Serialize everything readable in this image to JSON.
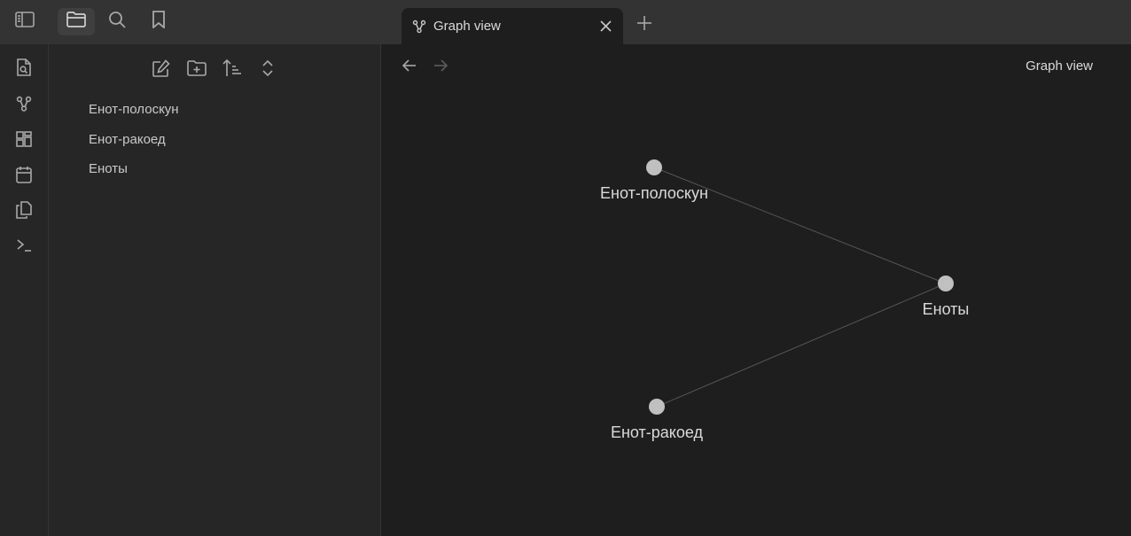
{
  "topbar": {
    "left_buttons": [
      {
        "name": "sidebar-toggle",
        "icon": "sidebar-icon"
      },
      {
        "name": "files",
        "icon": "folder-icon"
      },
      {
        "name": "search",
        "icon": "search-icon"
      },
      {
        "name": "bookmarks",
        "icon": "bookmark-icon"
      }
    ],
    "tab": {
      "title": "Graph view",
      "icon": "graph-icon"
    },
    "new_tab_icon": "plus-icon"
  },
  "ribbon": {
    "icons": [
      "file-search-icon",
      "graph-icon",
      "canvas-icon",
      "calendar-icon",
      "copy-icon",
      "terminal-icon"
    ]
  },
  "sidebar": {
    "tools": [
      "new-note-icon",
      "new-folder-icon",
      "sort-icon",
      "collapse-icon"
    ],
    "files": [
      "Енот-полоскун",
      "Енот-ракоед",
      "Еноты"
    ]
  },
  "main": {
    "view_title": "Graph view"
  },
  "graph": {
    "nodes": [
      {
        "id": "a",
        "label": "Енот-полоскун"
      },
      {
        "id": "b",
        "label": "Еноты"
      },
      {
        "id": "c",
        "label": "Енот-ракоед"
      }
    ],
    "edges": [
      [
        "a",
        "b"
      ],
      [
        "c",
        "b"
      ]
    ],
    "colors": {
      "node": "#c0c0c0",
      "edge": "#555555"
    }
  }
}
